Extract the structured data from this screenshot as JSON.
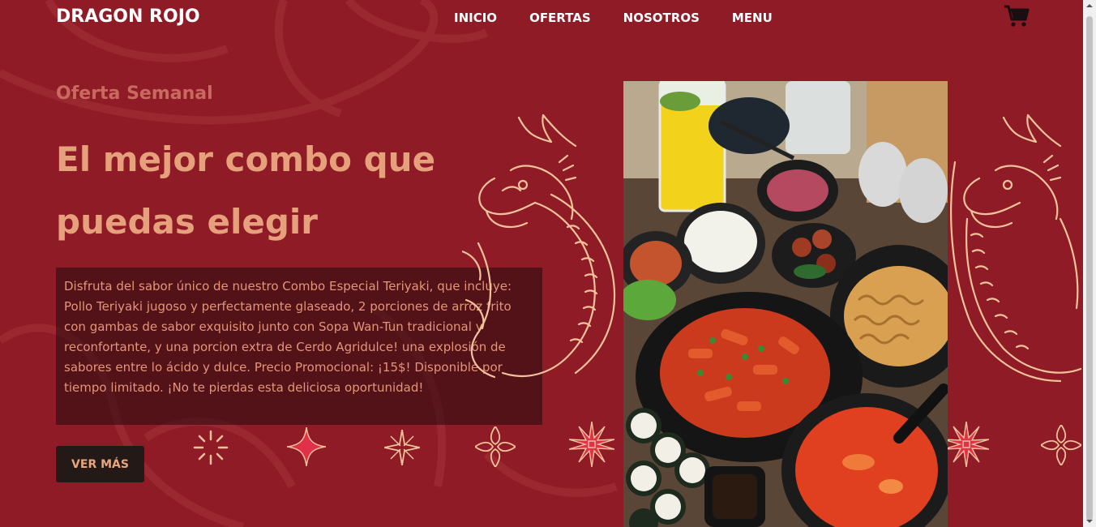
{
  "brand": {
    "name": "DRAGON ROJO"
  },
  "nav": {
    "items": [
      {
        "label": "INICIO"
      },
      {
        "label": "OFERTAS"
      },
      {
        "label": "NOSOTROS"
      },
      {
        "label": "MENU"
      }
    ]
  },
  "cart": {
    "icon": "cart-icon"
  },
  "hero": {
    "eyebrow": "Oferta Semanal",
    "headline": "El mejor combo que puedas elegir",
    "description": "Disfruta del sabor único de nuestro Combo Especial Teriyaki, que incluye: Pollo Teriyaki jugoso y perfectamente glaseado, 2 porciones de arroz frito con gambas de sabor exquisito junto con Sopa Wan-Tun tradicional y reconfortante, y una porcion extra de Cerdo Agridulce! una explosión de sabores entre lo ácido y dulce. Precio Promocional: ¡15$! Disponible por tiempo limitado. ¡No te pierdas esta deliciosa oportunidad!",
    "cta_label": "VER MÁS"
  },
  "colors": {
    "background": "#8e1b26",
    "headline": "#e6a07c",
    "eyebrow": "#c9695f",
    "button_bg": "#231a18",
    "dragon_line": "#f2c29a"
  }
}
